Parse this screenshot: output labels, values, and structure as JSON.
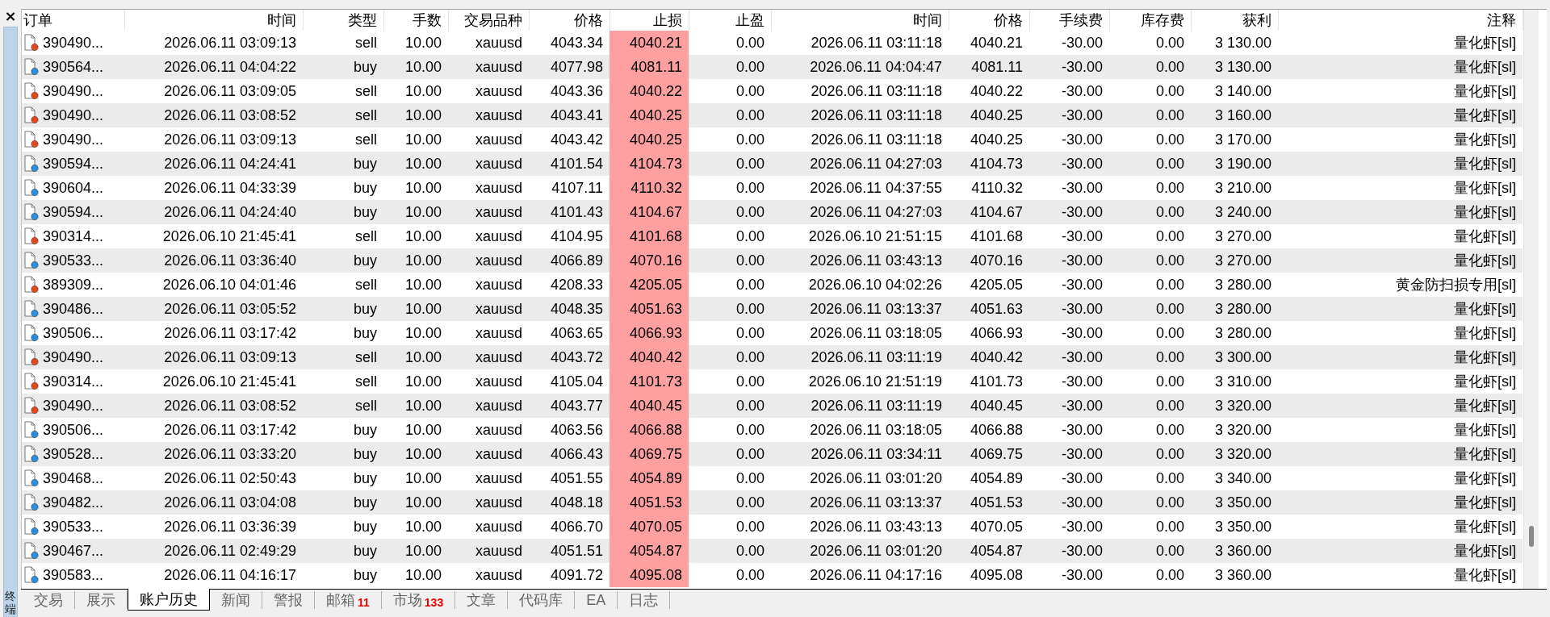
{
  "panel": {
    "close": "×",
    "title": "终端"
  },
  "table": {
    "columns": [
      {
        "label": "订单",
        "highlight": false,
        "sorted": false
      },
      {
        "label": "时间",
        "highlight": false,
        "sorted": false
      },
      {
        "label": "类型",
        "highlight": false,
        "sorted": false
      },
      {
        "label": "手数",
        "highlight": false,
        "sorted": false
      },
      {
        "label": "交易品种",
        "highlight": false,
        "sorted": false
      },
      {
        "label": "价格",
        "highlight": false,
        "sorted": false
      },
      {
        "label": "止损",
        "highlight": true,
        "sorted": false
      },
      {
        "label": "止盈",
        "highlight": false,
        "sorted": false
      },
      {
        "label": "时间",
        "highlight": false,
        "sorted": false
      },
      {
        "label": "价格",
        "highlight": false,
        "sorted": false
      },
      {
        "label": "手续费",
        "highlight": false,
        "sorted": false
      },
      {
        "label": "库存费",
        "highlight": false,
        "sorted": false
      },
      {
        "label": "获利",
        "highlight": false,
        "sorted": true
      },
      {
        "label": "注释",
        "highlight": false,
        "sorted": false
      }
    ],
    "rows": [
      {
        "kind": "sell",
        "cells": [
          "390490...",
          "2026.06.11 03:09:13",
          "sell",
          "10.00",
          "xauusd",
          "4043.34",
          "4040.21",
          "0.00",
          "2026.06.11 03:11:18",
          "4040.21",
          "-30.00",
          "0.00",
          "3 130.00",
          "量化虾[sl]"
        ]
      },
      {
        "kind": "buy",
        "cells": [
          "390564...",
          "2026.06.11 04:04:22",
          "buy",
          "10.00",
          "xauusd",
          "4077.98",
          "4081.11",
          "0.00",
          "2026.06.11 04:04:47",
          "4081.11",
          "-30.00",
          "0.00",
          "3 130.00",
          "量化虾[sl]"
        ]
      },
      {
        "kind": "sell",
        "cells": [
          "390490...",
          "2026.06.11 03:09:05",
          "sell",
          "10.00",
          "xauusd",
          "4043.36",
          "4040.22",
          "0.00",
          "2026.06.11 03:11:18",
          "4040.22",
          "-30.00",
          "0.00",
          "3 140.00",
          "量化虾[sl]"
        ]
      },
      {
        "kind": "sell",
        "cells": [
          "390490...",
          "2026.06.11 03:08:52",
          "sell",
          "10.00",
          "xauusd",
          "4043.41",
          "4040.25",
          "0.00",
          "2026.06.11 03:11:18",
          "4040.25",
          "-30.00",
          "0.00",
          "3 160.00",
          "量化虾[sl]"
        ]
      },
      {
        "kind": "sell",
        "cells": [
          "390490...",
          "2026.06.11 03:09:13",
          "sell",
          "10.00",
          "xauusd",
          "4043.42",
          "4040.25",
          "0.00",
          "2026.06.11 03:11:18",
          "4040.25",
          "-30.00",
          "0.00",
          "3 170.00",
          "量化虾[sl]"
        ]
      },
      {
        "kind": "buy",
        "cells": [
          "390594...",
          "2026.06.11 04:24:41",
          "buy",
          "10.00",
          "xauusd",
          "4101.54",
          "4104.73",
          "0.00",
          "2026.06.11 04:27:03",
          "4104.73",
          "-30.00",
          "0.00",
          "3 190.00",
          "量化虾[sl]"
        ]
      },
      {
        "kind": "buy",
        "cells": [
          "390604...",
          "2026.06.11 04:33:39",
          "buy",
          "10.00",
          "xauusd",
          "4107.11",
          "4110.32",
          "0.00",
          "2026.06.11 04:37:55",
          "4110.32",
          "-30.00",
          "0.00",
          "3 210.00",
          "量化虾[sl]"
        ]
      },
      {
        "kind": "buy",
        "cells": [
          "390594...",
          "2026.06.11 04:24:40",
          "buy",
          "10.00",
          "xauusd",
          "4101.43",
          "4104.67",
          "0.00",
          "2026.06.11 04:27:03",
          "4104.67",
          "-30.00",
          "0.00",
          "3 240.00",
          "量化虾[sl]"
        ]
      },
      {
        "kind": "sell",
        "cells": [
          "390314...",
          "2026.06.10 21:45:41",
          "sell",
          "10.00",
          "xauusd",
          "4104.95",
          "4101.68",
          "0.00",
          "2026.06.10 21:51:15",
          "4101.68",
          "-30.00",
          "0.00",
          "3 270.00",
          "量化虾[sl]"
        ]
      },
      {
        "kind": "buy",
        "cells": [
          "390533...",
          "2026.06.11 03:36:40",
          "buy",
          "10.00",
          "xauusd",
          "4066.89",
          "4070.16",
          "0.00",
          "2026.06.11 03:43:13",
          "4070.16",
          "-30.00",
          "0.00",
          "3 270.00",
          "量化虾[sl]"
        ]
      },
      {
        "kind": "sell",
        "cells": [
          "389309...",
          "2026.06.10 04:01:46",
          "sell",
          "10.00",
          "xauusd",
          "4208.33",
          "4205.05",
          "0.00",
          "2026.06.10 04:02:26",
          "4205.05",
          "-30.00",
          "0.00",
          "3 280.00",
          "黄金防扫损专用[sl]"
        ]
      },
      {
        "kind": "buy",
        "cells": [
          "390486...",
          "2026.06.11 03:05:52",
          "buy",
          "10.00",
          "xauusd",
          "4048.35",
          "4051.63",
          "0.00",
          "2026.06.11 03:13:37",
          "4051.63",
          "-30.00",
          "0.00",
          "3 280.00",
          "量化虾[sl]"
        ]
      },
      {
        "kind": "buy",
        "cells": [
          "390506...",
          "2026.06.11 03:17:42",
          "buy",
          "10.00",
          "xauusd",
          "4063.65",
          "4066.93",
          "0.00",
          "2026.06.11 03:18:05",
          "4066.93",
          "-30.00",
          "0.00",
          "3 280.00",
          "量化虾[sl]"
        ]
      },
      {
        "kind": "sell",
        "cells": [
          "390490...",
          "2026.06.11 03:09:13",
          "sell",
          "10.00",
          "xauusd",
          "4043.72",
          "4040.42",
          "0.00",
          "2026.06.11 03:11:19",
          "4040.42",
          "-30.00",
          "0.00",
          "3 300.00",
          "量化虾[sl]"
        ]
      },
      {
        "kind": "sell",
        "cells": [
          "390314...",
          "2026.06.10 21:45:41",
          "sell",
          "10.00",
          "xauusd",
          "4105.04",
          "4101.73",
          "0.00",
          "2026.06.10 21:51:19",
          "4101.73",
          "-30.00",
          "0.00",
          "3 310.00",
          "量化虾[sl]"
        ]
      },
      {
        "kind": "sell",
        "cells": [
          "390490...",
          "2026.06.11 03:08:52",
          "sell",
          "10.00",
          "xauusd",
          "4043.77",
          "4040.45",
          "0.00",
          "2026.06.11 03:11:19",
          "4040.45",
          "-30.00",
          "0.00",
          "3 320.00",
          "量化虾[sl]"
        ]
      },
      {
        "kind": "buy",
        "cells": [
          "390506...",
          "2026.06.11 03:17:42",
          "buy",
          "10.00",
          "xauusd",
          "4063.56",
          "4066.88",
          "0.00",
          "2026.06.11 03:18:05",
          "4066.88",
          "-30.00",
          "0.00",
          "3 320.00",
          "量化虾[sl]"
        ]
      },
      {
        "kind": "buy",
        "cells": [
          "390528...",
          "2026.06.11 03:33:20",
          "buy",
          "10.00",
          "xauusd",
          "4066.43",
          "4069.75",
          "0.00",
          "2026.06.11 03:34:11",
          "4069.75",
          "-30.00",
          "0.00",
          "3 320.00",
          "量化虾[sl]"
        ]
      },
      {
        "kind": "buy",
        "cells": [
          "390468...",
          "2026.06.11 02:50:43",
          "buy",
          "10.00",
          "xauusd",
          "4051.55",
          "4054.89",
          "0.00",
          "2026.06.11 03:01:20",
          "4054.89",
          "-30.00",
          "0.00",
          "3 340.00",
          "量化虾[sl]"
        ]
      },
      {
        "kind": "buy",
        "cells": [
          "390482...",
          "2026.06.11 03:04:08",
          "buy",
          "10.00",
          "xauusd",
          "4048.18",
          "4051.53",
          "0.00",
          "2026.06.11 03:13:37",
          "4051.53",
          "-30.00",
          "0.00",
          "3 350.00",
          "量化虾[sl]"
        ]
      },
      {
        "kind": "buy",
        "cells": [
          "390533...",
          "2026.06.11 03:36:39",
          "buy",
          "10.00",
          "xauusd",
          "4066.70",
          "4070.05",
          "0.00",
          "2026.06.11 03:43:13",
          "4070.05",
          "-30.00",
          "0.00",
          "3 350.00",
          "量化虾[sl]"
        ]
      },
      {
        "kind": "buy",
        "cells": [
          "390467...",
          "2026.06.11 02:49:29",
          "buy",
          "10.00",
          "xauusd",
          "4051.51",
          "4054.87",
          "0.00",
          "2026.06.11 03:01:20",
          "4054.87",
          "-30.00",
          "0.00",
          "3 360.00",
          "量化虾[sl]"
        ]
      },
      {
        "kind": "buy",
        "cells": [
          "390583...",
          "2026.06.11 04:16:17",
          "buy",
          "10.00",
          "xauusd",
          "4091.72",
          "4095.08",
          "0.00",
          "2026.06.11 04:17:16",
          "4095.08",
          "-30.00",
          "0.00",
          "3 360.00",
          "量化虾[sl]"
        ]
      }
    ]
  },
  "tabs": [
    {
      "label": "交易",
      "selected": false
    },
    {
      "label": "展示",
      "selected": false
    },
    {
      "label": "账户历史",
      "selected": true
    },
    {
      "label": "新闻",
      "selected": false
    },
    {
      "label": "警报",
      "selected": false
    },
    {
      "label": "邮箱",
      "badge": "11",
      "selected": false
    },
    {
      "label": "市场",
      "badge": "133",
      "selected": false
    },
    {
      "label": "文章",
      "selected": false
    },
    {
      "label": "代码库",
      "selected": false
    },
    {
      "label": "EA",
      "selected": false
    },
    {
      "label": "日志",
      "selected": false
    }
  ]
}
